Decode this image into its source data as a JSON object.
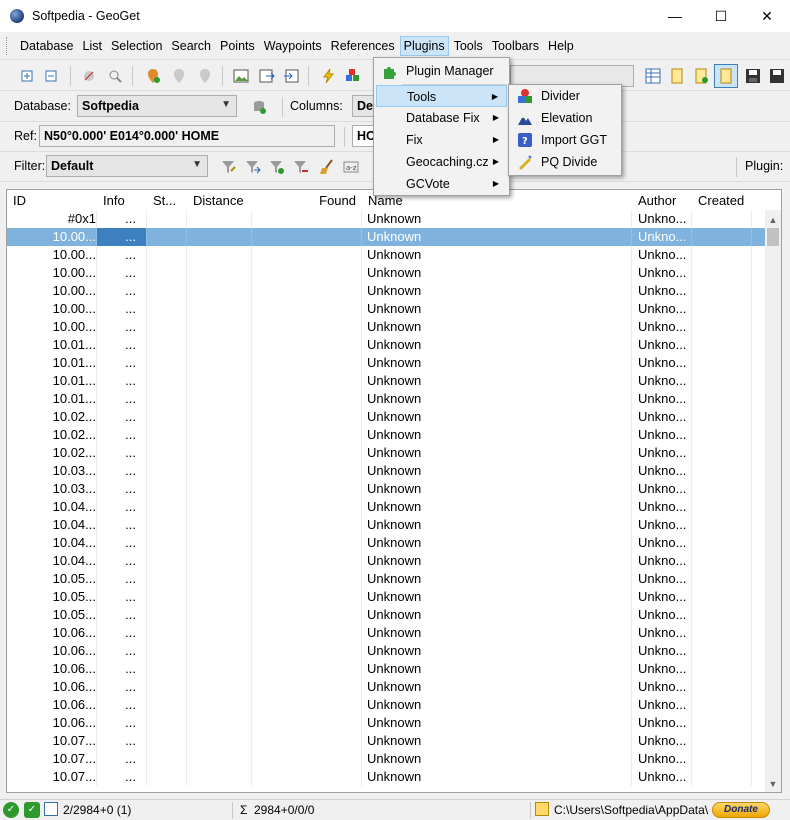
{
  "window": {
    "title": "Softpedia - GeoGet",
    "min_label": "—",
    "max_label": "☐",
    "close_label": "✕"
  },
  "menubar": {
    "items": [
      "Database",
      "List",
      "Selection",
      "Search",
      "Points",
      "Waypoints",
      "References",
      "Plugins",
      "Tools",
      "Toolbars",
      "Help"
    ]
  },
  "toolbar": {
    "database_label": "Database:",
    "database_value": "Softpedia",
    "columns_label": "Columns:",
    "columns_value": "De",
    "ref_label": "Ref:",
    "ref_value": "N50°0.000' E014°0.000' HOME",
    "ref_value2": "HO",
    "filter_label": "Filter:",
    "filter_value": "Default",
    "plugin_label": "Plugin:"
  },
  "plugins_menu": {
    "items": [
      {
        "label": "Plugin Manager",
        "icon": "puzzle-icon",
        "submenu": false
      },
      {
        "label": "Tools",
        "icon": "",
        "submenu": true,
        "highlighted": true
      },
      {
        "label": "Database Fix",
        "icon": "",
        "submenu": true
      },
      {
        "label": "Fix",
        "icon": "",
        "submenu": true
      },
      {
        "label": "Geocaching.cz",
        "icon": "",
        "submenu": true
      },
      {
        "label": "GCVote",
        "icon": "",
        "submenu": true
      }
    ]
  },
  "tools_menu": {
    "items": [
      {
        "label": "Divider",
        "icon": "divider-icon"
      },
      {
        "label": "Elevation",
        "icon": "elevation-icon"
      },
      {
        "label": "Import GGT",
        "icon": "import-icon"
      },
      {
        "label": "PQ Divide",
        "icon": "pq-divide-icon"
      }
    ]
  },
  "grid": {
    "columns": [
      "ID",
      "Info",
      "St...",
      "Distance",
      "Found",
      "Name",
      "Author",
      "Created"
    ],
    "rows": [
      {
        "id": "#0x1",
        "info": "...",
        "name": "Unknown",
        "author": "Unkno..."
      },
      {
        "id": "10.00...",
        "info": "...",
        "name": "Unknown",
        "author": "Unkno...",
        "selected": true
      },
      {
        "id": "10.00...",
        "info": "...",
        "name": "Unknown",
        "author": "Unkno..."
      },
      {
        "id": "10.00...",
        "info": "...",
        "name": "Unknown",
        "author": "Unkno..."
      },
      {
        "id": "10.00...",
        "info": "...",
        "name": "Unknown",
        "author": "Unkno..."
      },
      {
        "id": "10.00...",
        "info": "...",
        "name": "Unknown",
        "author": "Unkno..."
      },
      {
        "id": "10.00...",
        "info": "...",
        "name": "Unknown",
        "author": "Unkno..."
      },
      {
        "id": "10.01...",
        "info": "...",
        "name": "Unknown",
        "author": "Unkno..."
      },
      {
        "id": "10.01...",
        "info": "...",
        "name": "Unknown",
        "author": "Unkno..."
      },
      {
        "id": "10.01...",
        "info": "...",
        "name": "Unknown",
        "author": "Unkno..."
      },
      {
        "id": "10.01...",
        "info": "...",
        "name": "Unknown",
        "author": "Unkno..."
      },
      {
        "id": "10.02...",
        "info": "...",
        "name": "Unknown",
        "author": "Unkno..."
      },
      {
        "id": "10.02...",
        "info": "...",
        "name": "Unknown",
        "author": "Unkno..."
      },
      {
        "id": "10.02...",
        "info": "...",
        "name": "Unknown",
        "author": "Unkno..."
      },
      {
        "id": "10.03...",
        "info": "...",
        "name": "Unknown",
        "author": "Unkno..."
      },
      {
        "id": "10.03...",
        "info": "...",
        "name": "Unknown",
        "author": "Unkno..."
      },
      {
        "id": "10.04...",
        "info": "...",
        "name": "Unknown",
        "author": "Unkno..."
      },
      {
        "id": "10.04...",
        "info": "...",
        "name": "Unknown",
        "author": "Unkno..."
      },
      {
        "id": "10.04...",
        "info": "...",
        "name": "Unknown",
        "author": "Unkno..."
      },
      {
        "id": "10.04...",
        "info": "...",
        "name": "Unknown",
        "author": "Unkno..."
      },
      {
        "id": "10.05...",
        "info": "...",
        "name": "Unknown",
        "author": "Unkno..."
      },
      {
        "id": "10.05...",
        "info": "...",
        "name": "Unknown",
        "author": "Unkno..."
      },
      {
        "id": "10.05...",
        "info": "...",
        "name": "Unknown",
        "author": "Unkno..."
      },
      {
        "id": "10.06...",
        "info": "...",
        "name": "Unknown",
        "author": "Unkno..."
      },
      {
        "id": "10.06...",
        "info": "...",
        "name": "Unknown",
        "author": "Unkno..."
      },
      {
        "id": "10.06...",
        "info": "...",
        "name": "Unknown",
        "author": "Unkno..."
      },
      {
        "id": "10.06...",
        "info": "...",
        "name": "Unknown",
        "author": "Unkno..."
      },
      {
        "id": "10.06...",
        "info": "...",
        "name": "Unknown",
        "author": "Unkno..."
      },
      {
        "id": "10.06...",
        "info": "...",
        "name": "Unknown",
        "author": "Unkno..."
      },
      {
        "id": "10.07...",
        "info": "...",
        "name": "Unknown",
        "author": "Unkno..."
      },
      {
        "id": "10.07...",
        "info": "...",
        "name": "Unknown",
        "author": "Unkno..."
      },
      {
        "id": "10.07...",
        "info": "...",
        "name": "Unknown",
        "author": "Unkno..."
      }
    ]
  },
  "statusbar": {
    "selection": "2/2984+0 (1)",
    "sigma": "Σ",
    "totals": "2984+0/0/0",
    "path": "C:\\Users\\Softpedia\\AppData\\",
    "donate": "Donate"
  },
  "colors": {
    "selection": "#7fb3dd",
    "menu_highlight": "#cce4f7"
  }
}
